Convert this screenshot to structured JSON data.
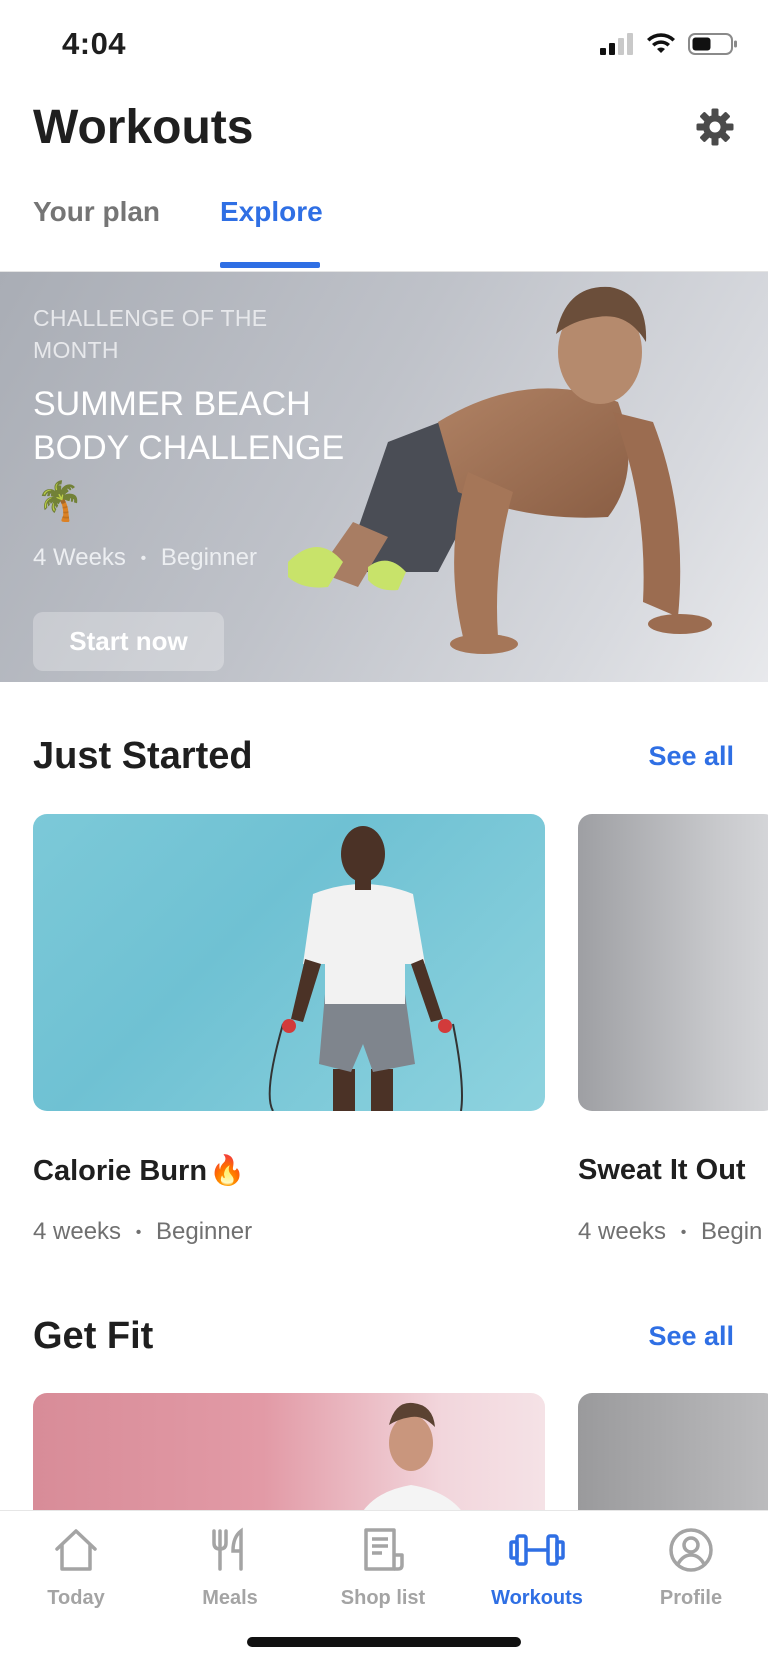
{
  "status_bar": {
    "time": "4:04"
  },
  "header": {
    "title": "Workouts",
    "settings_icon": "gear-icon"
  },
  "tabs": [
    {
      "label": "Your plan",
      "active": false
    },
    {
      "label": "Explore",
      "active": true
    }
  ],
  "banner": {
    "kicker": "CHALLENGE OF THE MONTH",
    "title": "SUMMER BEACH BODY CHALLENGE",
    "emoji": "🌴",
    "duration": "4 Weeks",
    "level": "Beginner",
    "button": "Start now"
  },
  "sections": [
    {
      "title": "Just Started",
      "see_all": "See all",
      "cards": [
        {
          "title": "Calorie Burn",
          "emoji": "🔥",
          "duration": "4 weeks",
          "level": "Beginner"
        },
        {
          "title": "Sweat It Out",
          "duration": "4 weeks",
          "level": "Begin"
        }
      ]
    },
    {
      "title": "Get Fit",
      "see_all": "See all"
    }
  ],
  "bottom_nav": [
    {
      "label": "Today",
      "icon": "home-icon",
      "active": false
    },
    {
      "label": "Meals",
      "icon": "fork-knife-icon",
      "active": false
    },
    {
      "label": "Shop list",
      "icon": "receipt-icon",
      "active": false
    },
    {
      "label": "Workouts",
      "icon": "dumbbell-icon",
      "active": true
    },
    {
      "label": "Profile",
      "icon": "profile-icon",
      "active": false
    }
  ],
  "colors": {
    "accent": "#2f6fe4",
    "inactive": "#a4a4a4",
    "text": "#1f1f1f"
  },
  "separator": "•"
}
